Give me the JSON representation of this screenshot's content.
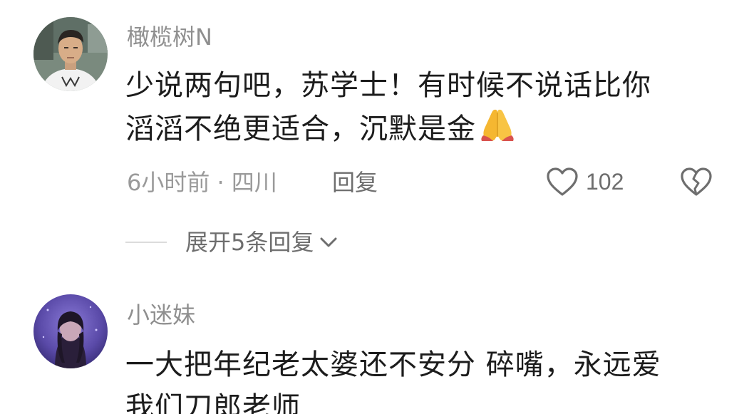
{
  "comments": [
    {
      "username": "橄榄树N",
      "text_lines": [
        "少说两句吧，苏学士！有时候不说话比你",
        "滔滔不绝更适合，沉默是金"
      ],
      "emoji": "praying-hands-emoji",
      "time_location": "6小时前 · 四川",
      "reply_label": "回复",
      "like_count": "102",
      "expand_label": "展开5条回复"
    },
    {
      "username": "小迷妹",
      "text_lines": [
        "一大把年纪老太婆还不安分 碎嘴，永远爱",
        "我们刀郎老师"
      ]
    }
  ],
  "colors": {
    "username": "#8f8f8f",
    "text": "#1c1c1c",
    "meta": "#9a9a9a",
    "action": "#6e6e6e"
  }
}
